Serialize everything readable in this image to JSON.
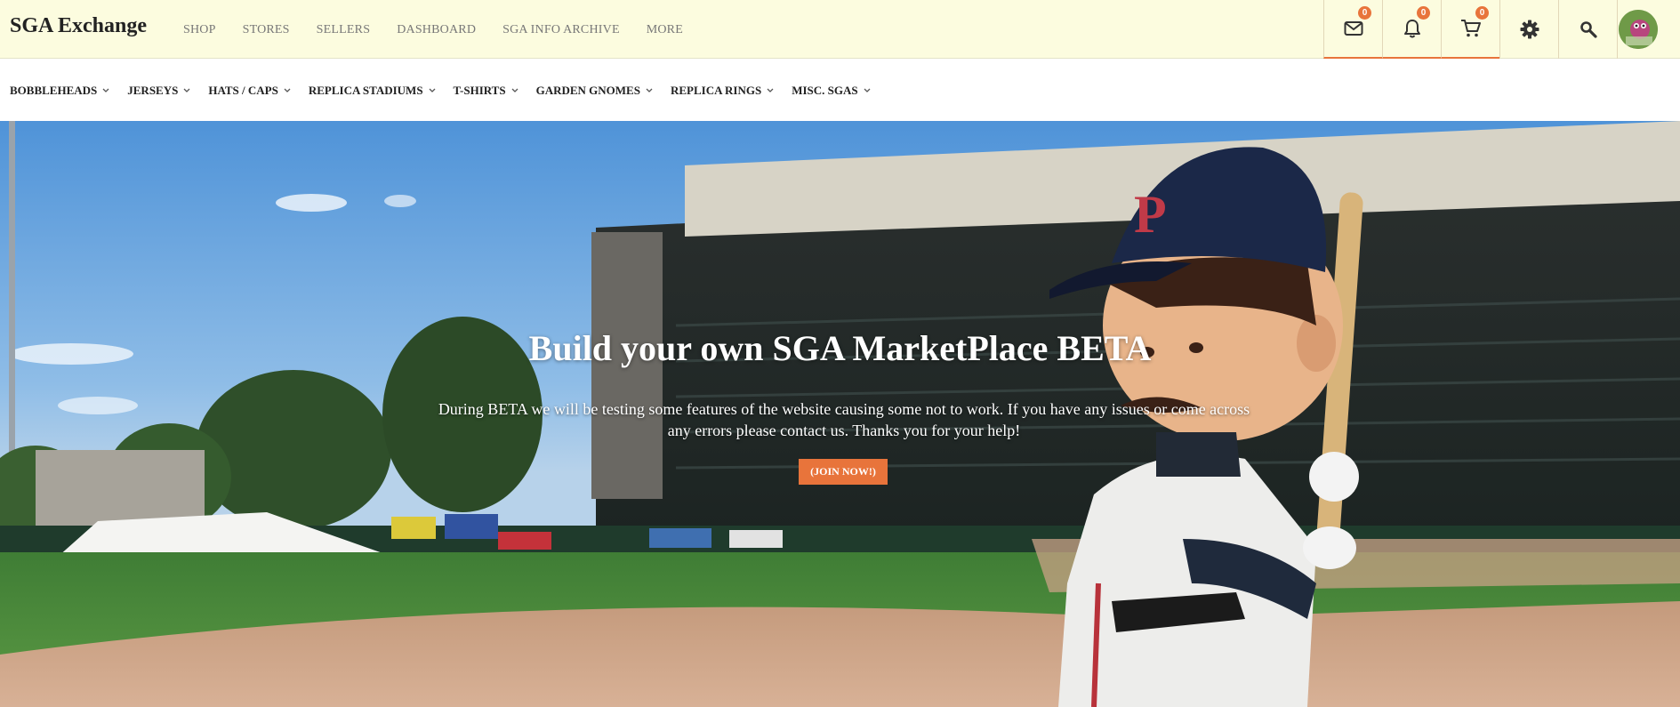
{
  "brand": "SGA Exchange",
  "top_nav": [
    "SHOP",
    "STORES",
    "SELLERS",
    "DASHBOARD",
    "SGA INFO ARCHIVE",
    "MORE"
  ],
  "header_icons": {
    "messages": {
      "icon": "mail-icon",
      "badge": "0"
    },
    "notifications": {
      "icon": "bell-icon",
      "badge": "0"
    },
    "cart": {
      "icon": "cart-icon",
      "badge": "0"
    },
    "settings": {
      "icon": "gear-icon"
    },
    "search": {
      "icon": "search-icon"
    },
    "profile": {
      "icon": "user-avatar"
    }
  },
  "categories": [
    "BOBBLEHEADS",
    "JERSEYS",
    "HATS / CAPS",
    "REPLICA STADIUMS",
    "T-SHIRTS",
    "GARDEN GNOMES",
    "REPLICA RINGS",
    "MISC. SGAS"
  ],
  "hero": {
    "title": "Build your own SGA MarketPlace BETA",
    "text": "During BETA we will be testing some features of the website causing some not to work. If you have any issues or come across any errors please contact us. Thanks you for your help!",
    "button_label": "(JOIN NOW!)"
  },
  "colors": {
    "accent": "#e8743b",
    "topbar_bg": "#fcfcdf"
  }
}
